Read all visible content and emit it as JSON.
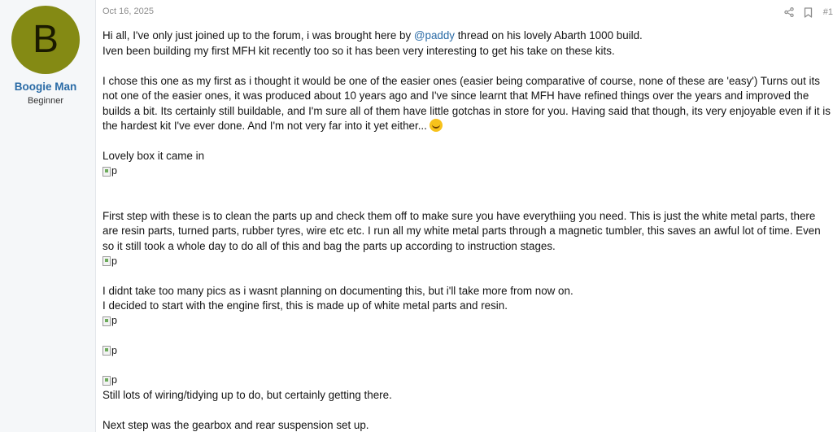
{
  "user": {
    "avatar_letter": "B",
    "avatar_color": "#848a14",
    "name": "Boogie Man",
    "title": "Beginner"
  },
  "post": {
    "date": "Oct 16, 2025",
    "number": "#1",
    "actions": [
      "share-icon",
      "bookmark-icon"
    ],
    "intro_before": "Hi all, I've only just joined up to the forum, i was brought here by ",
    "mention": "@paddy",
    "intro_after": " thread on his lovely Abarth 1000 build.",
    "line2": "Iven been building my first MFH kit recently too so it has been very interesting to get his take on these kits.",
    "para2": "I chose this one as my first as i thought it would be one of the easier ones (easier being comparative of course, none of these are 'easy') Turns out its not one of the easier ones, it was produced about 10 years ago and I've since learnt that MFH have refined things over the years and improved the builds a bit. Its certainly still buildable, and I'm sure all of them have little gotchas in store for you. Having said that though, its very enjoyable even if it is the hardest kit I've ever done. And I'm not very far into it yet either...",
    "emoji": "rofl-emoji",
    "line_box": "Lovely box it came in",
    "img_alt": "p",
    "para3": "First step with these is to clean the parts up and check them off to make sure you have everythiing you need. This is just the white metal parts, there are resin parts, turned parts, rubber tyres, wire etc etc. I run all my white metal parts through a magnetic tumbler, this saves an awful lot of time. Even so it still took a whole day to do all of this and bag the parts up according to instruction stages.",
    "line_pics": "I didnt take too many pics as i wasnt planning on documenting this, but i'll take more from now on.",
    "line_engine": "I decided to start with the engine first, this is made up of white metal parts and resin.",
    "line_wiring": "Still lots of wiring/tidying up to do, but certainly getting there.",
    "line_next": "Next step was the gearbox and rear suspension set up."
  }
}
